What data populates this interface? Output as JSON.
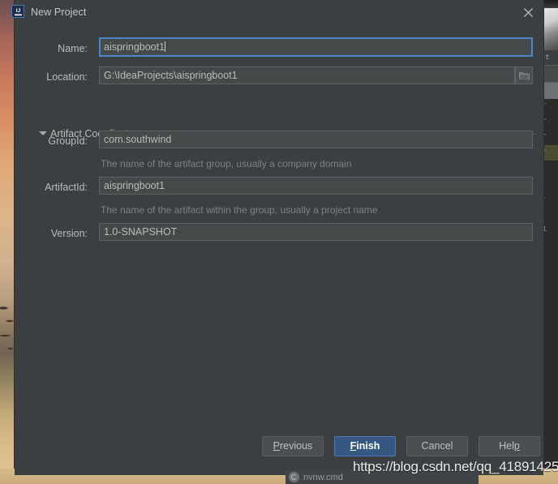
{
  "window": {
    "title": "New Project",
    "icon": "intellij-idea-icon",
    "close_icon": "close-icon"
  },
  "form": {
    "name": {
      "label": "Name:",
      "value": "aispringboot1",
      "focused": true
    },
    "location": {
      "label": "Location:",
      "value": "G:\\IdeaProjects\\aispringboot1",
      "browse_icon": "folder-icon"
    },
    "section": {
      "title": "Artifact Coordinates",
      "expanded": true,
      "collapse_icon": "triangle-down-icon"
    },
    "group_id": {
      "label": "GroupId:",
      "value": "com.southwind",
      "hint": "The name of the artifact group, usually a company domain"
    },
    "artifact_id": {
      "label": "ArtifactId:",
      "value": "aispringboot1",
      "hint": "The name of the artifact within the group, usually a project name"
    },
    "version": {
      "label": "Version:",
      "value": "1.0-SNAPSHOT"
    }
  },
  "footer": {
    "previous": {
      "label": "Previous",
      "mnemonic": "P",
      "default": false
    },
    "finish": {
      "label": "Finish",
      "mnemonic": "F",
      "default": true
    },
    "cancel": {
      "label": "Cancel",
      "mnemonic": "",
      "default": false
    },
    "help": {
      "label": "Help",
      "mnemonic": "H",
      "default": false
    }
  },
  "overlay": {
    "watermark": "https://blog.csdn.net/qq_41891425"
  },
  "taskbar": {
    "tray_item_label": "nvnw.cmd",
    "tray_icon": "refresh-circle-icon"
  },
  "background": {
    "editor_tab_label": "ct",
    "code_lines": [
      "r",
      "r",
      "r",
      "r",
      "",
      "",
      "-",
      "",
      "1"
    ]
  },
  "colors": {
    "dialog_bg": "#3c3f41",
    "field_bg": "#45494a",
    "focus_blue": "#4a86c8",
    "default_button": "#365880",
    "text": "#bbbbbb",
    "hint_text": "#7d8184"
  }
}
